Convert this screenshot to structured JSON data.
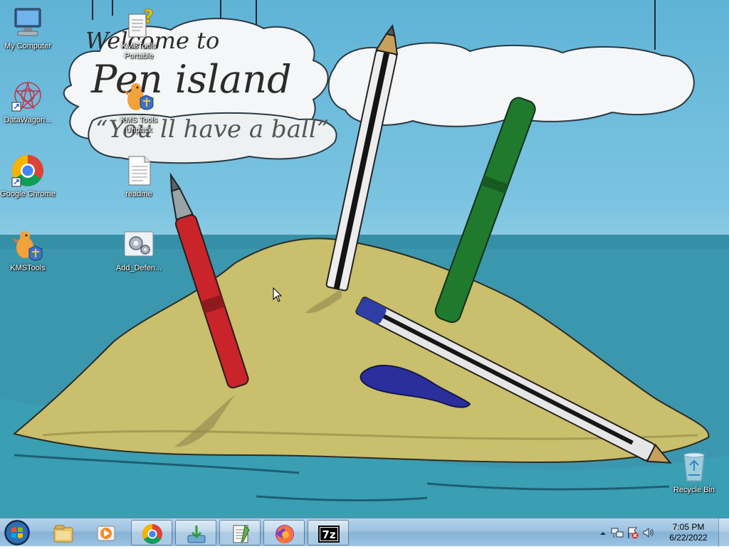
{
  "wallpaper": {
    "line1": "Welcome to",
    "line2": "Pen island",
    "line3": "“You ll have a ball”"
  },
  "desktop_icons": [
    {
      "name": "My Computer",
      "icon": "computer-icon"
    },
    {
      "name": "DataWagon...",
      "icon": "datawagon-icon"
    },
    {
      "name": "Google Chrome",
      "icon": "chrome-icon"
    },
    {
      "name": "KMSTools",
      "icon": "kmstools-icon"
    },
    {
      "name": "KMSTools Portable",
      "icon": "kmstools-portable-icon"
    },
    {
      "name": "KMS Tools Unpack",
      "icon": "kmstools-unpack-icon"
    },
    {
      "name": "readme",
      "icon": "text-file-icon"
    },
    {
      "name": "Add_Defen...",
      "icon": "registry-script-icon"
    },
    {
      "name": "Recycle Bin",
      "icon": "recycle-bin-icon"
    }
  ],
  "taskbar": {
    "pinned": [
      "file-explorer-icon",
      "media-player-icon",
      "chrome-icon",
      "installer-icon",
      "notepad-icon",
      "firefox-icon",
      "7zip-icon"
    ],
    "clock_time": "7:05 PM",
    "clock_date": "6/22/2022"
  },
  "colors": {
    "sky": "#7cc4e1",
    "sea": "#3b97ad",
    "sand": "#c9bf6c",
    "taskbar": "#9cc2e0"
  }
}
